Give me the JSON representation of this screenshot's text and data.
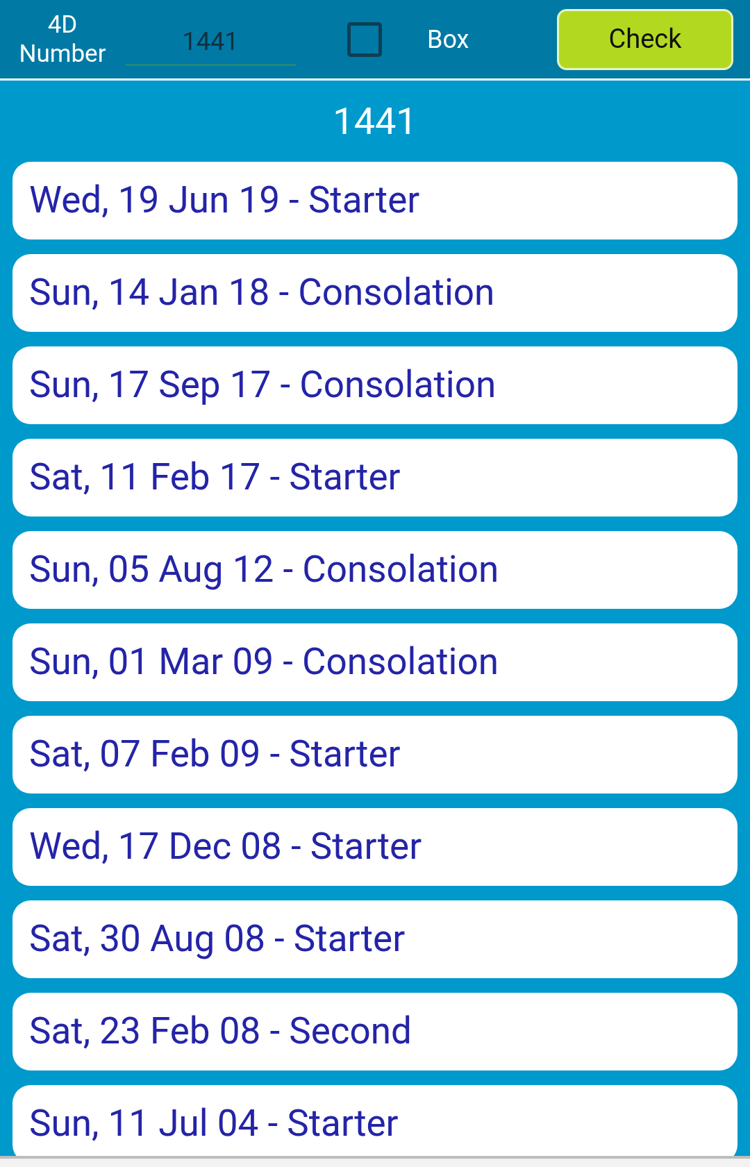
{
  "header": {
    "label": "4D Number",
    "number_field": {
      "value": "1441"
    },
    "box_checkbox": {
      "label": "Box",
      "checked": false
    },
    "check_button": "Check"
  },
  "result_title": "1441",
  "results": [
    "Wed, 19 Jun 19 - Starter",
    "Sun, 14 Jan 18 - Consolation",
    "Sun, 17 Sep 17 - Consolation",
    "Sat, 11 Feb 17 - Starter",
    "Sun, 05 Aug 12 - Consolation",
    "Sun, 01 Mar 09 - Consolation",
    "Sat, 07 Feb 09 - Starter",
    "Wed, 17 Dec 08 - Starter",
    "Sat, 30 Aug 08 - Starter",
    "Sat, 23 Feb 08 - Second",
    "Sun, 11 Jul 04 - Starter"
  ]
}
